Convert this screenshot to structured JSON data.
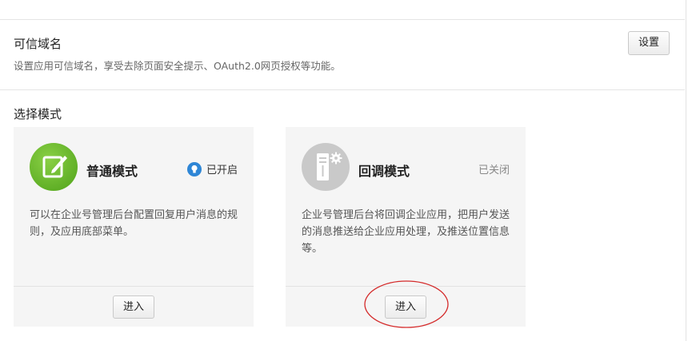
{
  "trusted_domain": {
    "title": "可信域名",
    "description": "设置应用可信域名，享受去除页面安全提示、OAuth2.0网页授权等功能。",
    "settings_button": "设置"
  },
  "mode_section": {
    "title": "选择模式",
    "cards": [
      {
        "name": "普通模式",
        "status": "已开启",
        "icon": "edit-icon",
        "description": "可以在企业号管理后台配置回复用户消息的规则，及应用底部菜单。",
        "enter_button": "进入"
      },
      {
        "name": "回调模式",
        "status": "已关闭",
        "icon": "server-gear-icon",
        "description": "企业号管理后台将回调企业应用，把用户发送的消息推送给企业应用处理，及推送位置信息等。",
        "enter_button": "进入"
      }
    ]
  },
  "colors": {
    "active_green": "#5bb21f",
    "status_blue": "#2e86d6",
    "annotation_red": "#d42a2a"
  }
}
